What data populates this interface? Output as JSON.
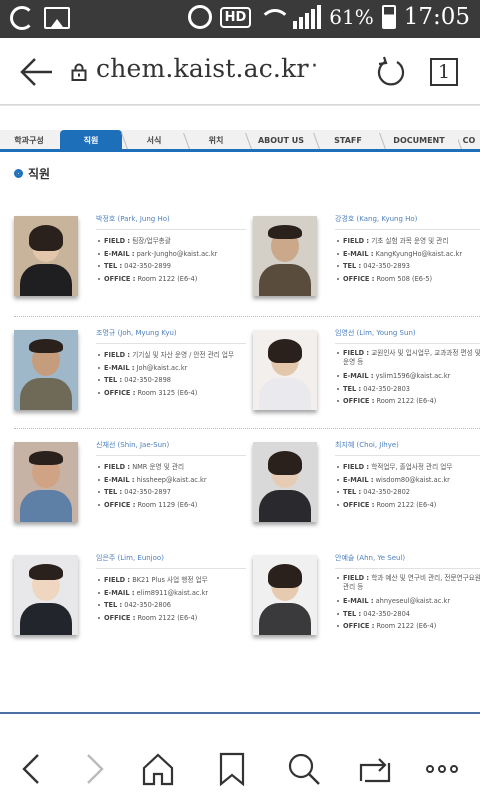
{
  "status_bar": {
    "battery": "61%",
    "time": "17:05",
    "hd_label": "HD"
  },
  "browser": {
    "url": "chem.kaist.ac.kr",
    "url_more": "···",
    "tab_count": "1"
  },
  "nav": {
    "tabs": [
      {
        "label": "학과구성"
      },
      {
        "label": "직원"
      },
      {
        "label": "서식"
      },
      {
        "label": "위치"
      },
      {
        "label": "ABOUT US"
      },
      {
        "label": "STAFF"
      },
      {
        "label": "DOCUMENT"
      },
      {
        "label": "CO"
      }
    ],
    "active_index": 1
  },
  "page": {
    "title": "직원"
  },
  "labels": {
    "field": "FIELD :",
    "email": "E-MAIL :",
    "tel": "TEL :",
    "office": "OFFICE :"
  },
  "staff": [
    {
      "name": "박정호 (Park, Jung Ho)",
      "field": "팀장/업무총괄",
      "email": "park-Jungho@kaist.ac.kr",
      "tel": "042-350-2899",
      "office": "Room 2122 (E6-4)"
    },
    {
      "name": "강경호 (Kang, Kyung Ho)",
      "field": "기초 실험 과목 운영 및 관리",
      "email": "KangKyungHo@kaist.ac.kr",
      "tel": "042-350-2893",
      "office": "Room 508 (E6-5)"
    },
    {
      "name": "조명규 (Joh, Myung Kyu)",
      "field": "기기실 및 자산 운영 / 안전 관리 업무",
      "email": "Joh@kaist.ac.kr",
      "tel": "042-350-2898",
      "office": "Room 3125 (E6-4)"
    },
    {
      "name": "임영선 (Lim, Young Sun)",
      "field": "교원인사 및 입시업무, 교과과정 편성 및 운영 등",
      "email": "yslim1596@kaist.ac.kr",
      "tel": "042-350-2803",
      "office": "Room 2122 (E6-4)"
    },
    {
      "name": "신재선 (Shin, Jae-Sun)",
      "field": "NMR 운영 및 관리",
      "email": "hissheep@kaist.ac.kr",
      "tel": "042-350-2897",
      "office": "Room 1129 (E6-4)"
    },
    {
      "name": "최지혜 (Choi, Jihye)",
      "field": "학적업무, 졸업사정 관리 업무",
      "email": "wisdom80@kaist.ac.kr",
      "tel": "042-350-2802",
      "office": "Room 2122 (E6-4)"
    },
    {
      "name": "임은주 (Lim, Eunjoo)",
      "field": "BK21 Plus 사업 행정 업무",
      "email": "elim8911@kaist.ac.kr",
      "tel": "042-350-2806",
      "office": "Room 2122 (E6-4)"
    },
    {
      "name": "안예슬 (Ahn, Ye Seul)",
      "field": "학과 예산 및 연구비 관리, 전문연구요원 관리 등",
      "email": "ahnyeseul@kaist.ac.kr",
      "tel": "042-350-2804",
      "office": "Room 2122 (E6-4)"
    }
  ],
  "colors": {
    "accent": "#1e6fba",
    "name_text": "#4b7fbf",
    "status_bar": "#3a3a3a"
  }
}
